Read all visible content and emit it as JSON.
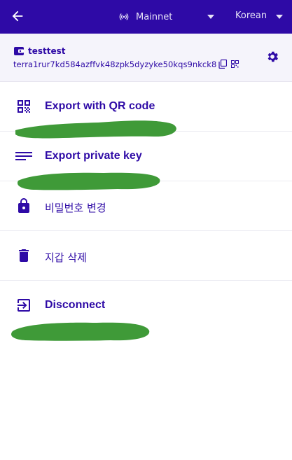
{
  "header": {
    "back_icon": "arrow-left-icon",
    "network_icon": "broadcast-icon",
    "network_label": "Mainnet",
    "language_label": "Korean",
    "dropdown_icon": "caret-down-icon",
    "background_color": "#2e0aa6"
  },
  "wallet": {
    "icon": "wallet-icon",
    "name": "testtest",
    "address": "terra1rur7kd584azffvk48zpk5dyzyke50kqs9nkck8",
    "copy_icon": "copy-icon",
    "qr_icon": "qr-icon",
    "settings_icon": "gear-icon"
  },
  "menu": {
    "items": [
      {
        "icon": "qr-code-icon",
        "label": "Export with QR code"
      },
      {
        "icon": "list-lines-icon",
        "label": "Export private key"
      },
      {
        "icon": "lock-icon",
        "label": "비밀번호 변경"
      },
      {
        "icon": "trash-icon",
        "label": "지갑 삭제"
      },
      {
        "icon": "logout-icon",
        "label": "Disconnect"
      }
    ]
  },
  "colors": {
    "accent": "#2e0aa6",
    "redaction": "#3f9a38"
  }
}
